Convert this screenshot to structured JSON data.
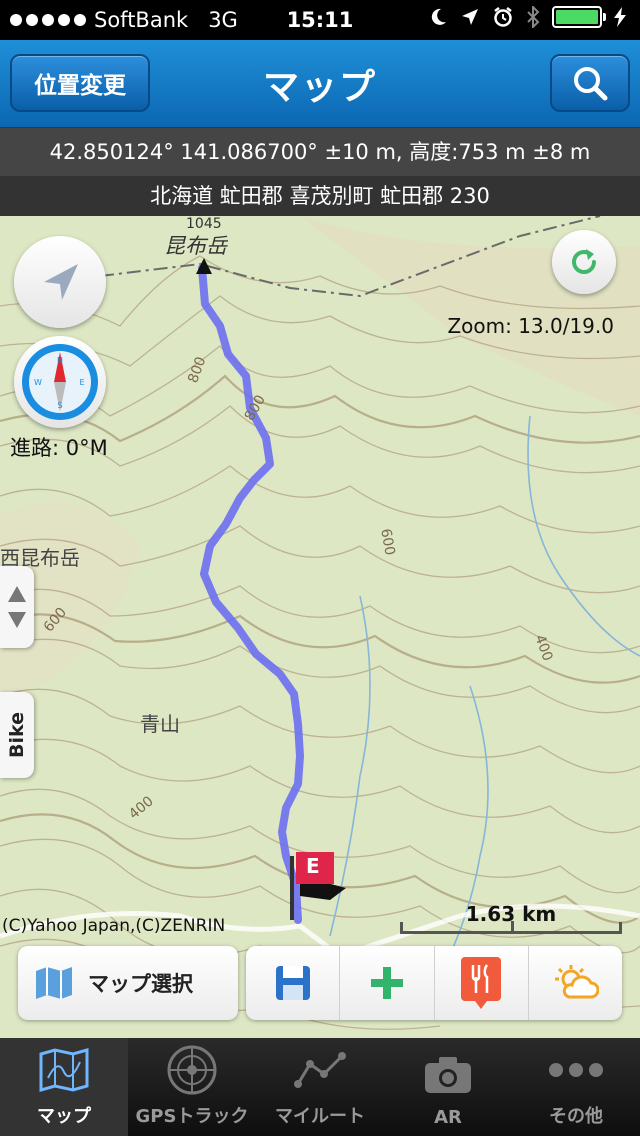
{
  "status_bar": {
    "carrier": "SoftBank",
    "network": "3G",
    "time": "15:11",
    "battery_color": "#4cd964"
  },
  "nav": {
    "title": "マップ",
    "left_button": "位置変更",
    "right_button_icon": "search-icon"
  },
  "location": {
    "coords": "42.850124° 141.086700° ±10 m, 高度:753 m ±8 m",
    "address": "北海道 虻田郡 喜茂別町 虻田郡 230"
  },
  "map": {
    "zoom": "Zoom: 13.0/19.0",
    "heading": "進路: 0°M",
    "copyright": "(C)Yahoo Japan,(C)ZENRIN",
    "scale": "1.63 km",
    "side_tab_label": "Bike",
    "marker_label": "E",
    "track_color": "#6b6ff0",
    "labels": {
      "peak_elevation": "1045",
      "peak_name": "昆布岳",
      "west_peak": "西昆布岳",
      "area": "青山",
      "c800a": "800",
      "c800b": "800",
      "c600a": "600",
      "c600b": "600",
      "c400a": "400",
      "c400b": "400"
    }
  },
  "toolbar": {
    "map_select": "マップ選択",
    "icons": [
      "save-icon",
      "add-icon",
      "restaurant-icon",
      "weather-icon"
    ]
  },
  "tabs": [
    {
      "label": "マップ",
      "icon": "map-icon",
      "active": true
    },
    {
      "label": "GPSトラック",
      "icon": "radar-icon",
      "active": false
    },
    {
      "label": "マイルート",
      "icon": "route-icon",
      "active": false
    },
    {
      "label": "AR",
      "icon": "camera-icon",
      "active": false
    },
    {
      "label": "その他",
      "icon": "more-icon",
      "active": false
    }
  ]
}
